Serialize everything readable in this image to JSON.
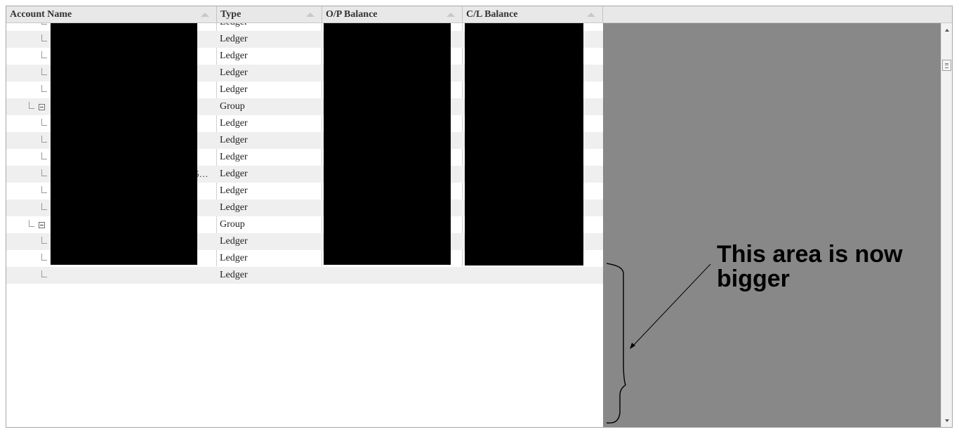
{
  "columns": [
    {
      "label": "Account Name"
    },
    {
      "label": "Type"
    },
    {
      "label": "O/P Balance"
    },
    {
      "label": "C/L Balance"
    }
  ],
  "rows": [
    {
      "type": "Ledger",
      "kind": "ledger"
    },
    {
      "type": "Ledger",
      "kind": "ledger"
    },
    {
      "type": "Ledger",
      "kind": "ledger"
    },
    {
      "type": "Ledger",
      "kind": "ledger"
    },
    {
      "type": "Group",
      "kind": "group"
    },
    {
      "type": "Ledger",
      "kind": "ledger"
    },
    {
      "type": "Ledger",
      "kind": "ledger"
    },
    {
      "type": "Ledger",
      "kind": "ledger"
    },
    {
      "type": "Ledger",
      "kind": "ledger",
      "name_fragment": "5…"
    },
    {
      "type": "Ledger",
      "kind": "ledger"
    },
    {
      "type": "Ledger",
      "kind": "ledger"
    },
    {
      "type": "Group",
      "kind": "group"
    },
    {
      "type": "Ledger",
      "kind": "ledger"
    },
    {
      "type": "Ledger",
      "kind": "ledger"
    },
    {
      "type": "Ledger",
      "kind": "ledger"
    }
  ],
  "annotation": {
    "text": "This area is now bigger",
    "color": "#000000"
  },
  "colors": {
    "empty_area": "#888888",
    "alt_row": "#efefef",
    "header": "#e8e8e8",
    "redaction": "#000000"
  }
}
